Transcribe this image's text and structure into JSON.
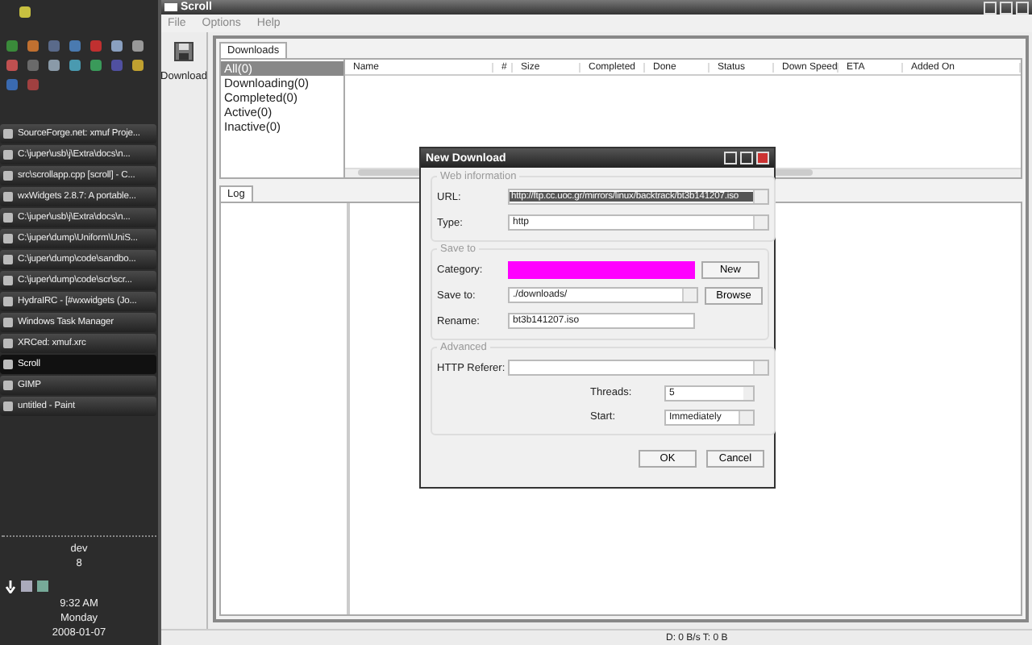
{
  "taskbar": {
    "tasks": [
      {
        "label": "SourceForge.net: xmuf Proje...",
        "selected": false
      },
      {
        "label": "C:\\juper\\usb\\j\\Extra\\docs\\n...",
        "selected": false
      },
      {
        "label": "src\\scrollapp.cpp [scroll] - C...",
        "selected": false
      },
      {
        "label": "wxWidgets 2.8.7: A portable...",
        "selected": false
      },
      {
        "label": "C:\\juper\\usb\\j\\Extra\\docs\\n...",
        "selected": false
      },
      {
        "label": "C:\\juper\\dump\\Uniform\\UniS...",
        "selected": false
      },
      {
        "label": "C:\\juper\\dump\\code\\sandbo...",
        "selected": false
      },
      {
        "label": "C:\\juper\\dump\\code\\scr\\scr...",
        "selected": false
      },
      {
        "label": "HydraIRC - [#wxwidgets (Jo...",
        "selected": false
      },
      {
        "label": "Windows Task Manager",
        "selected": false
      },
      {
        "label": "XRCed: xmuf.xrc",
        "selected": false
      },
      {
        "label": "Scroll",
        "selected": true
      },
      {
        "label": "GIMP",
        "selected": false
      },
      {
        "label": "untitled - Paint",
        "selected": false
      }
    ],
    "user": "dev",
    "user_line_2": "8",
    "time": "9:32 AM",
    "day": "Monday",
    "date": "2008-01-07"
  },
  "window": {
    "title": "Scroll",
    "menu": [
      "File",
      "Options",
      "Help"
    ],
    "toolbar_button": "Download",
    "tabs": [
      {
        "label": "Downloads",
        "selected": true
      }
    ],
    "filters": [
      {
        "label": "All(0)",
        "selected": true
      },
      {
        "label": "Downloading(0)",
        "selected": false
      },
      {
        "label": "Completed(0)",
        "selected": false
      },
      {
        "label": "Active(0)",
        "selected": false
      },
      {
        "label": "Inactive(0)",
        "selected": false
      }
    ],
    "columns": [
      "Name",
      "#",
      "Size",
      "Completed",
      "Done",
      "Status",
      "Down Speed",
      "ETA",
      "Added On"
    ],
    "log_tabs": [
      {
        "label": "Log",
        "selected": true
      }
    ],
    "status_bar": "D: 0 B/s T: 0 B"
  },
  "dialog": {
    "title": "New Download",
    "web_information": {
      "legend": "Web information",
      "url_label": "URL:",
      "url_value": "http://ftp.cc.uoc.gr/mirrors/linux/backtrack/bt3b141207.iso",
      "type_label": "Type:",
      "type_value": "http"
    },
    "save_to": {
      "legend": "Save to",
      "category_label": "Category:",
      "new_button": "New",
      "save_label": "Save to:",
      "save_value": "./downloads/",
      "browse_button": "Browse",
      "rename_label": "Rename:",
      "rename_value": "bt3b141207.iso"
    },
    "advanced": {
      "legend": "Advanced",
      "referer_label": "HTTP Referer:",
      "threads_label": "Threads:",
      "threads_value": "5",
      "start_label": "Start:",
      "start_value": "Immediately"
    },
    "buttons": [
      "OK",
      "Cancel"
    ]
  }
}
